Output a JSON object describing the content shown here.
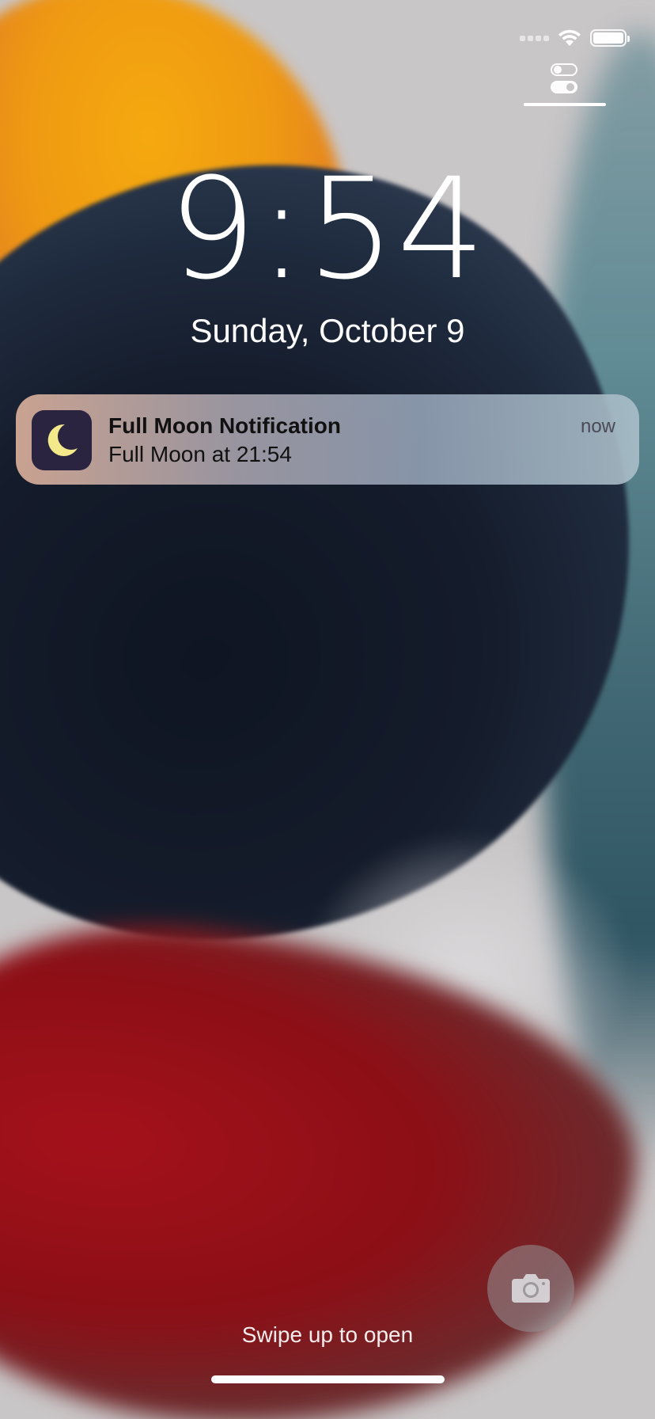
{
  "status_bar": {
    "signal_icon": "cellular-signal-icon",
    "wifi_icon": "wifi-icon",
    "battery_icon": "battery-icon",
    "battery_level": 1.0,
    "focus_icon": "focus-toggle-icon"
  },
  "lock_screen": {
    "time": "9:54",
    "date": "Sunday, October 9"
  },
  "notification": {
    "app_icon": "crescent-moon-icon",
    "title": "Full Moon Notification",
    "body": "Full Moon at 21:54",
    "timestamp": "now",
    "icon_bg_color": "#2a2440",
    "moon_color": "#f3e98a"
  },
  "bottom": {
    "camera_icon": "camera-icon",
    "swipe_hint": "Swipe up to open"
  }
}
